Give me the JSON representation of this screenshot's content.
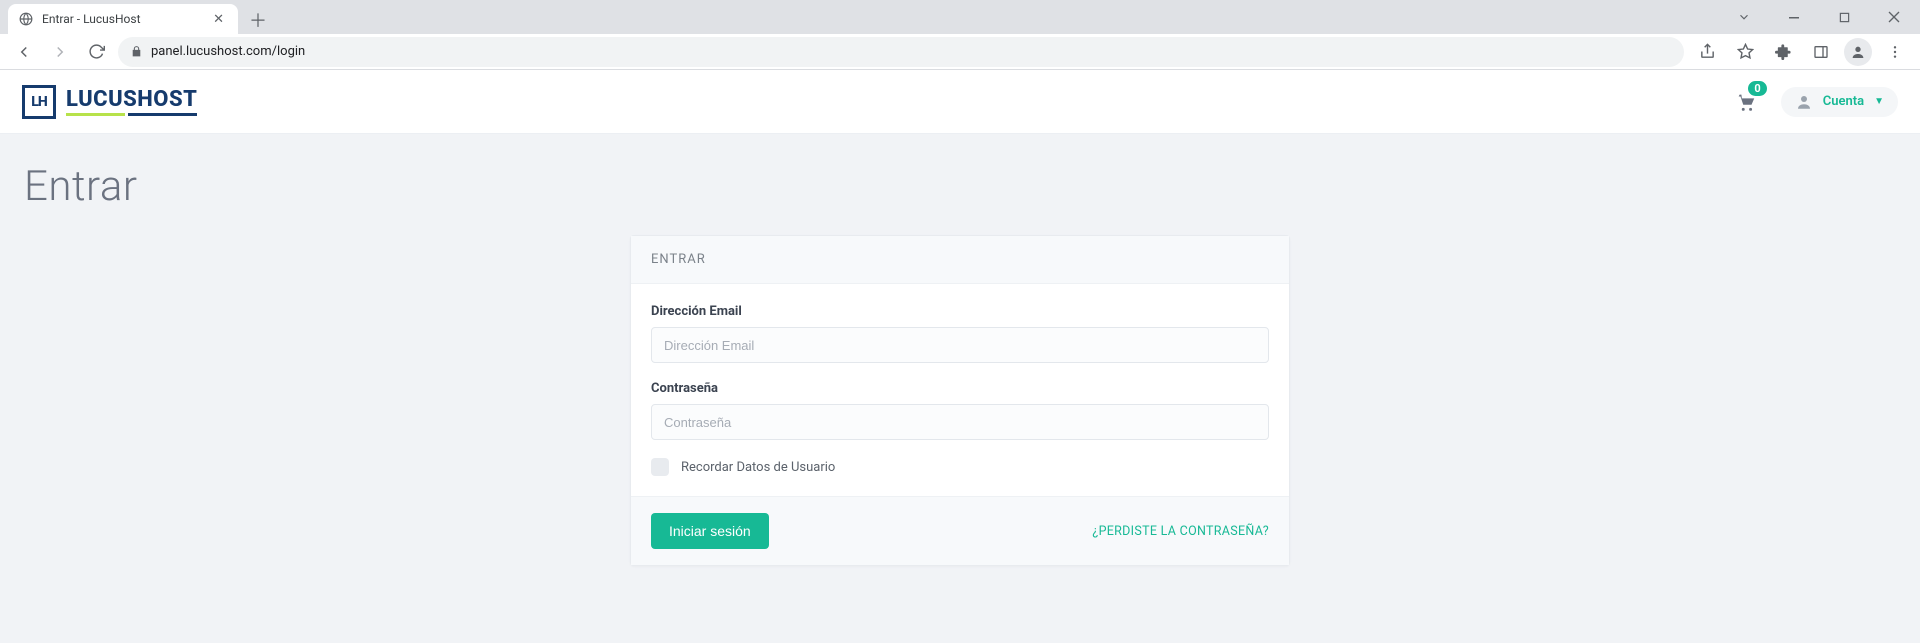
{
  "browser": {
    "tab_title": "Entrar - LucusHost",
    "url": "panel.lucushost.com/login"
  },
  "header": {
    "logo_mark": "LH",
    "logo_word": "LUCUSHOST",
    "cart_count": "0",
    "account_label": "Cuenta"
  },
  "page": {
    "title": "Entrar"
  },
  "login": {
    "card_title": "ENTRAR",
    "email_label": "Dirección Email",
    "email_placeholder": "Dirección Email",
    "password_label": "Contraseña",
    "password_placeholder": "Contraseña",
    "remember_label": "Recordar Datos de Usuario",
    "submit_label": "Iniciar sesión",
    "forgot_label": "¿PERDISTE LA CONTRASEÑA?"
  }
}
